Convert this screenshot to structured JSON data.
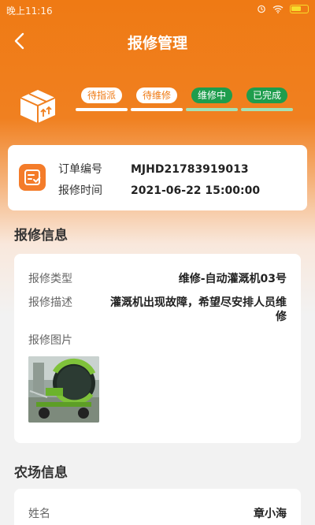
{
  "status_bar": {
    "time": "晚上11:16"
  },
  "header": {
    "title": "报修管理"
  },
  "steps": [
    {
      "label": "待指派",
      "state": "todo"
    },
    {
      "label": "待维修",
      "state": "todo"
    },
    {
      "label": "维修中",
      "state": "active"
    },
    {
      "label": "已完成",
      "state": "active"
    }
  ],
  "order": {
    "number_label": "订单编号",
    "number_value": "MJHD21783919013",
    "time_label": "报修时间",
    "time_value": "2021-06-22 15:00:00"
  },
  "repair_info": {
    "section_title": "报修信息",
    "type_label": "报修类型",
    "type_value": "维修-自动灌溉机03号",
    "desc_label": "报修描述",
    "desc_line1": "灌溉机出现故障，希望尽安排人员维",
    "desc_line2": "修",
    "images_label": "报修图片"
  },
  "farm_info": {
    "section_title": "农场信息",
    "name_label": "姓名",
    "name_value": "章小海"
  },
  "colors": {
    "accent": "#ef7a14",
    "active": "#1e9d4d"
  }
}
